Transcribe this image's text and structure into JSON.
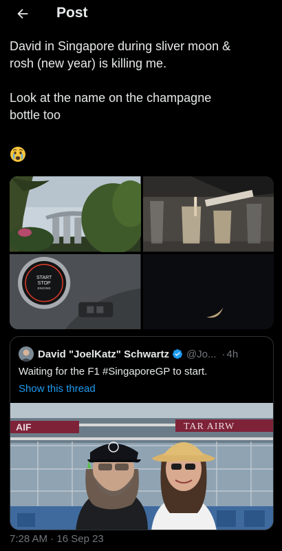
{
  "header": {
    "title": "Post",
    "back_icon": "arrow-left-icon"
  },
  "post": {
    "paragraph_1": "David in Singapore during sliver moon &\nrosh (new year) is killing me.",
    "paragraph_2": "Look at the name on the champagne\nbottle too",
    "emoji": "crying-face-emoji"
  },
  "media": {
    "tiles": [
      {
        "name": "Marina Bay Sands photo"
      },
      {
        "name": "Champagne pouring photo"
      },
      {
        "name": "Car start/stop button photo",
        "button_lines": [
          "START",
          "STOP",
          "ENGINE"
        ]
      },
      {
        "name": "Crescent moon photo"
      }
    ]
  },
  "quote": {
    "author_name": "David \"JoelKatz\" Schwartz",
    "handle": "@Jo...",
    "separator": "·",
    "time": "4h",
    "text": "Waiting for the F1 #SingaporeGP to start.",
    "show_thread": "Show this thread",
    "photo_banner_left": "AIF",
    "photo_banner_right": "TAR AIRW"
  },
  "timestamp": "7:28 AM · 16 Sep 23",
  "colors": {
    "background": "#000000",
    "text": "#e7e9ea",
    "muted": "#71767b",
    "link": "#1d9bf0",
    "border": "#2f3336"
  }
}
